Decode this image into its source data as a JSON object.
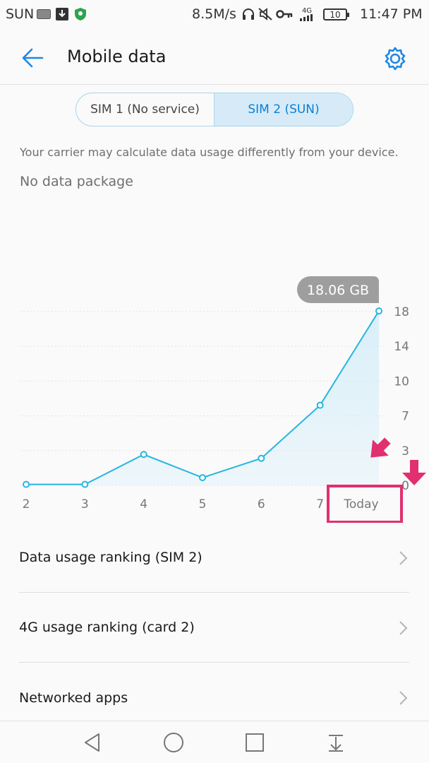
{
  "status_bar": {
    "carrier": "SUN",
    "speed": "8.5M/s",
    "battery": "10",
    "network": "4G",
    "time": "11:47 PM"
  },
  "app_bar": {
    "title": "Mobile data"
  },
  "sim_tabs": [
    {
      "label": "SIM 1 (No service)",
      "selected": false
    },
    {
      "label": "SIM 2 (SUN)",
      "selected": true
    }
  ],
  "carrier_note": "Your carrier may calculate data usage differently from your device.",
  "package_status": "No data package",
  "chart_data": {
    "type": "area",
    "categories": [
      "2",
      "3",
      "4",
      "5",
      "6",
      "7",
      "Today"
    ],
    "values": [
      0.1,
      0.1,
      3.2,
      0.8,
      2.8,
      8.3,
      18.06
    ],
    "highlight_label": "18.06 GB",
    "y_ticks": [
      "0",
      "3",
      "7",
      "10",
      "14",
      "18"
    ],
    "ylim": [
      0,
      18
    ],
    "grid": true,
    "colors": {
      "line": "#26b6e2",
      "fill": "#d7eef9"
    }
  },
  "annotations": {
    "arrow_color": "#e0306f",
    "highlight_box_color": "#e0306f"
  },
  "list_items": [
    {
      "label": "Data usage ranking (SIM 2)"
    },
    {
      "label": "4G usage ranking (card 2)"
    },
    {
      "label": "Networked apps"
    }
  ],
  "accent_color": "#1e88e5"
}
